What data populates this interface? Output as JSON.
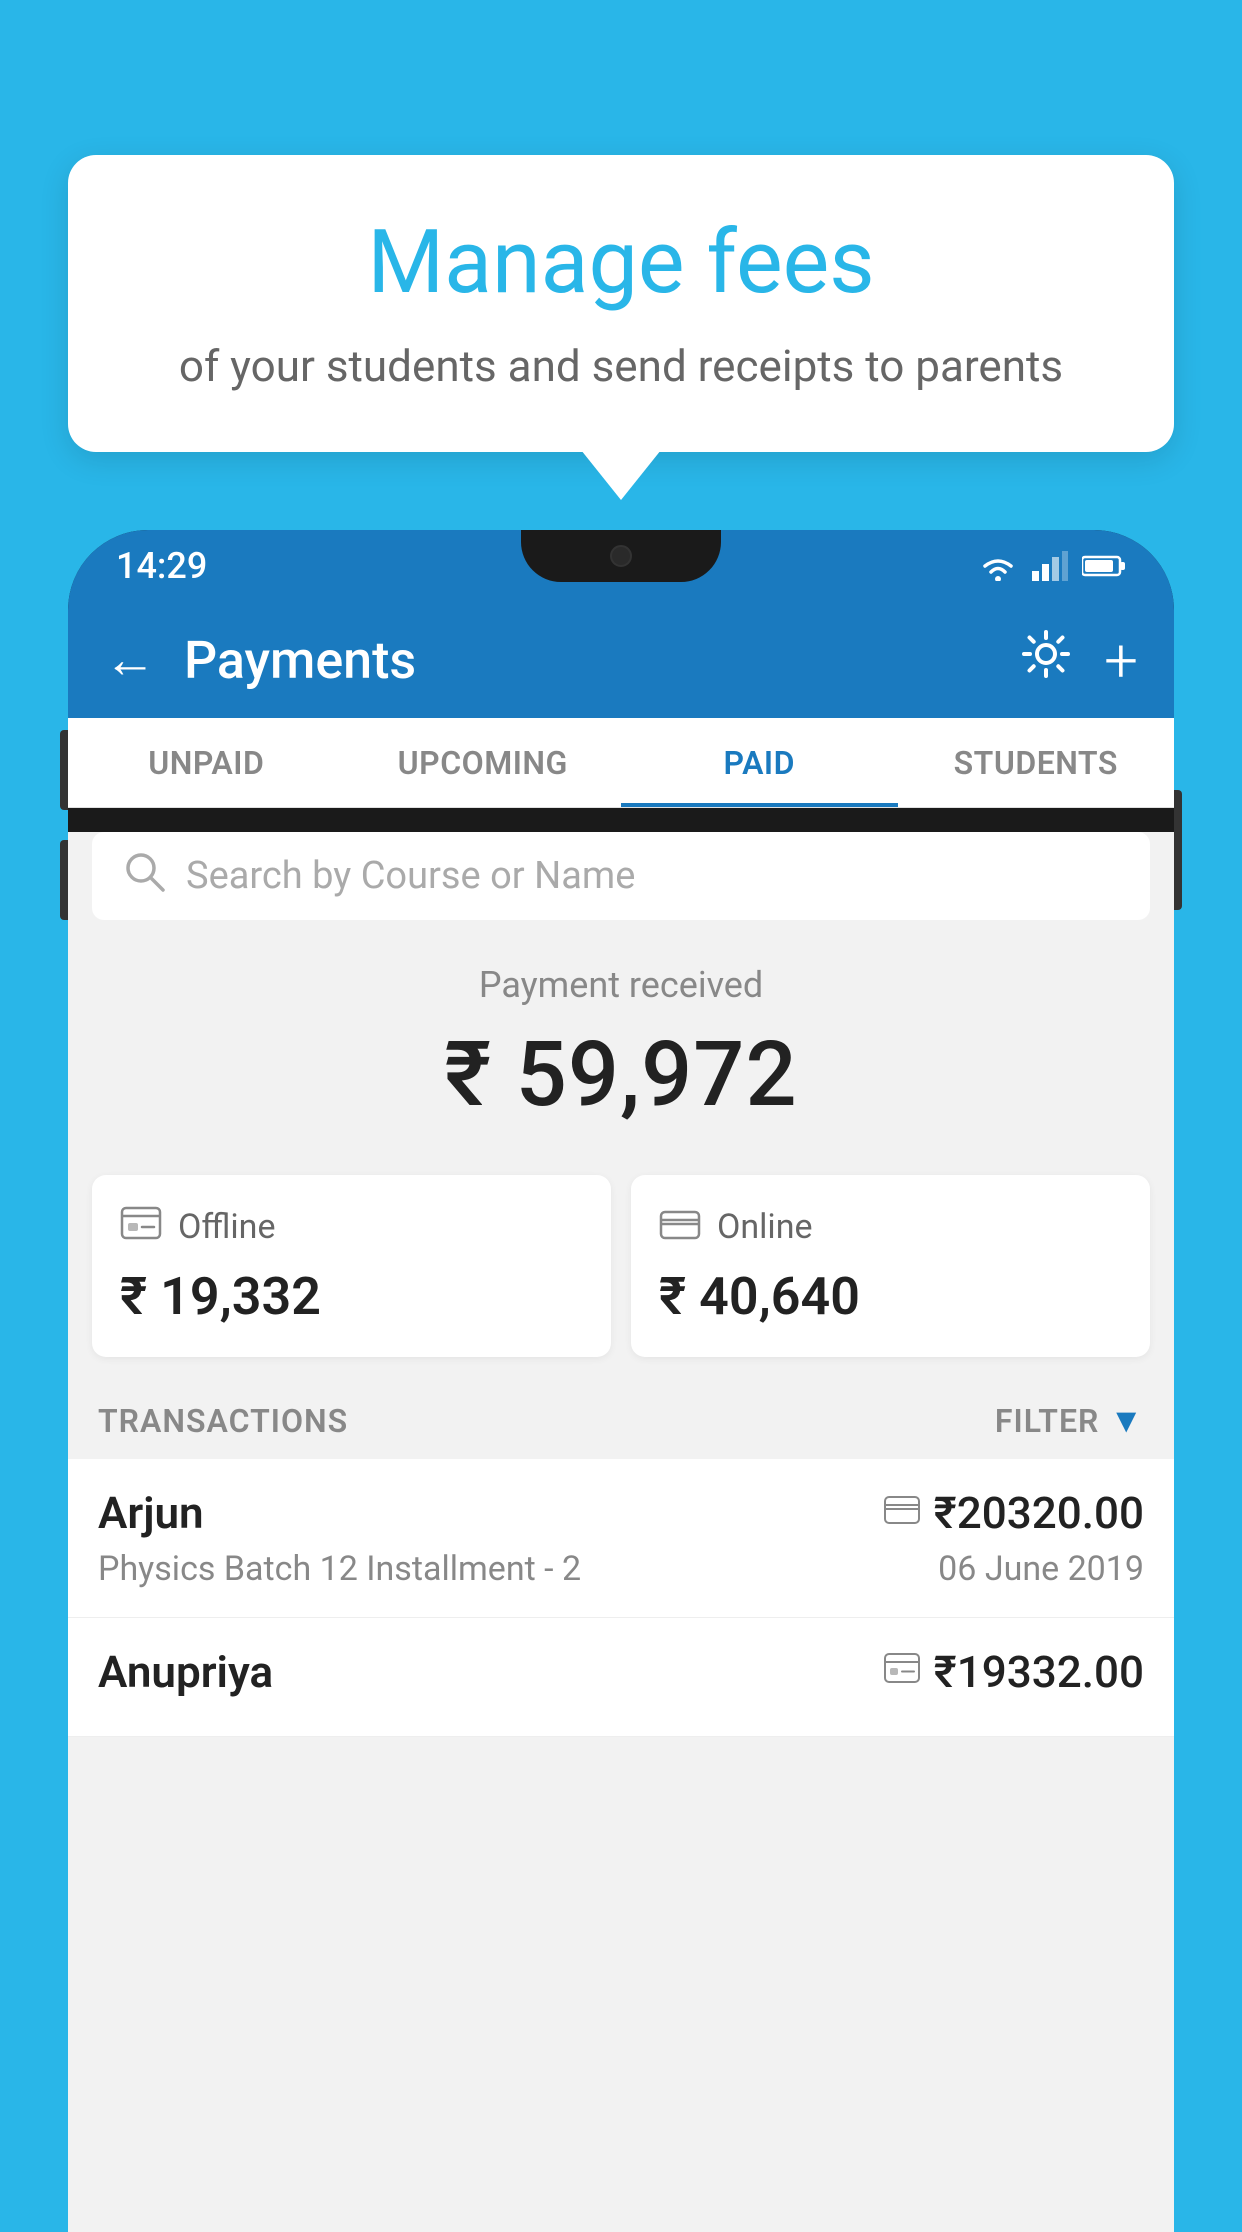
{
  "background_color": "#29b6e8",
  "speech_bubble": {
    "title": "Manage fees",
    "subtitle": "of your students and send receipts to parents"
  },
  "status_bar": {
    "time": "14:29",
    "wifi": "▼",
    "signal": "▲",
    "battery": "▐"
  },
  "header": {
    "title": "Payments",
    "back_label": "←",
    "settings_label": "⚙",
    "add_label": "+"
  },
  "tabs": [
    {
      "id": "unpaid",
      "label": "UNPAID",
      "active": false
    },
    {
      "id": "upcoming",
      "label": "UPCOMING",
      "active": false
    },
    {
      "id": "paid",
      "label": "PAID",
      "active": true
    },
    {
      "id": "students",
      "label": "STUDENTS",
      "active": false
    }
  ],
  "search": {
    "placeholder": "Search by Course or Name"
  },
  "payment_received": {
    "label": "Payment received",
    "amount": "₹ 59,972"
  },
  "payment_cards": {
    "offline": {
      "label": "Offline",
      "amount": "₹ 19,332"
    },
    "online": {
      "label": "Online",
      "amount": "₹ 40,640"
    }
  },
  "transactions_section": {
    "label": "TRANSACTIONS",
    "filter_label": "FILTER"
  },
  "transactions": [
    {
      "name": "Arjun",
      "amount": "₹20320.00",
      "course": "Physics Batch 12 Installment - 2",
      "date": "06 June 2019",
      "payment_type": "online"
    },
    {
      "name": "Anupriya",
      "amount": "₹19332.00",
      "course": "",
      "date": "",
      "payment_type": "offline"
    }
  ]
}
